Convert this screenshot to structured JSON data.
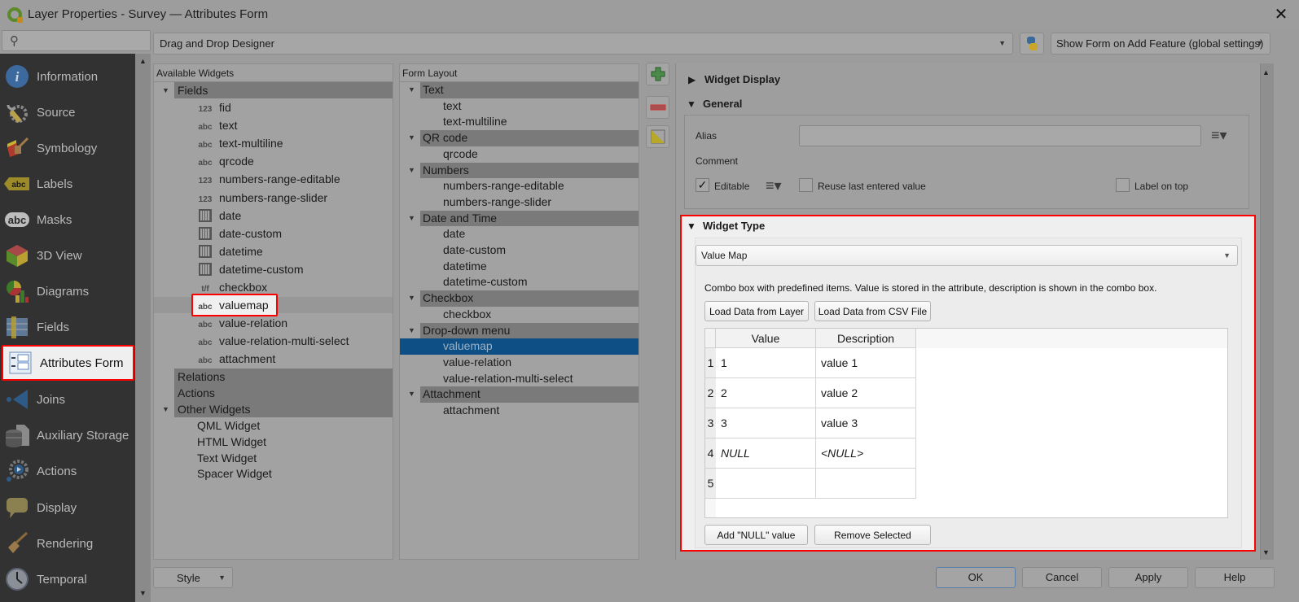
{
  "window": {
    "title": "Layer Properties - Survey — Attributes Form",
    "close_icon": "✕"
  },
  "sidebar": {
    "search_placeholder": "",
    "items": [
      {
        "label": "Information",
        "icon": "information-icon"
      },
      {
        "label": "Source",
        "icon": "source-icon"
      },
      {
        "label": "Symbology",
        "icon": "symbology-icon"
      },
      {
        "label": "Labels",
        "icon": "labels-icon"
      },
      {
        "label": "Masks",
        "icon": "masks-icon"
      },
      {
        "label": "3D View",
        "icon": "3d-view-icon"
      },
      {
        "label": "Diagrams",
        "icon": "diagrams-icon"
      },
      {
        "label": "Fields",
        "icon": "fields-icon"
      },
      {
        "label": "Attributes Form",
        "icon": "attributes-form-icon",
        "active": true
      },
      {
        "label": "Joins",
        "icon": "joins-icon"
      },
      {
        "label": "Auxiliary Storage",
        "icon": "auxiliary-storage-icon"
      },
      {
        "label": "Actions",
        "icon": "actions-icon"
      },
      {
        "label": "Display",
        "icon": "display-icon"
      },
      {
        "label": "Rendering",
        "icon": "rendering-icon"
      },
      {
        "label": "Temporal",
        "icon": "temporal-icon"
      }
    ]
  },
  "toolbar": {
    "mode": "Drag and Drop Designer",
    "show_form": "Show Form on Add Feature (global settings)"
  },
  "available_widgets": {
    "header": "Available Widgets",
    "fields_group": "Fields",
    "fields": [
      {
        "type": "123",
        "name": "fid"
      },
      {
        "type": "abc",
        "name": "text"
      },
      {
        "type": "abc",
        "name": "text-multiline"
      },
      {
        "type": "abc",
        "name": "qrcode"
      },
      {
        "type": "123",
        "name": "numbers-range-editable"
      },
      {
        "type": "123",
        "name": "numbers-range-slider"
      },
      {
        "type": "date",
        "name": "date"
      },
      {
        "type": "date",
        "name": "date-custom"
      },
      {
        "type": "datetime",
        "name": "datetime"
      },
      {
        "type": "datetime",
        "name": "datetime-custom"
      },
      {
        "type": "t/f",
        "name": "checkbox"
      },
      {
        "type": "abc",
        "name": "valuemap"
      },
      {
        "type": "abc",
        "name": "value-relation"
      },
      {
        "type": "abc",
        "name": "value-relation-multi-select"
      },
      {
        "type": "abc",
        "name": "attachment"
      }
    ],
    "relations_group": "Relations",
    "actions_group": "Actions",
    "other_group": "Other Widgets",
    "other": [
      "QML Widget",
      "HTML Widget",
      "Text Widget",
      "Spacer Widget"
    ]
  },
  "form_layout": {
    "header": "Form Layout",
    "groups": [
      {
        "name": "Text",
        "items": [
          "text",
          "text-multiline"
        ]
      },
      {
        "name": "QR code",
        "items": [
          "qrcode"
        ]
      },
      {
        "name": "Numbers",
        "items": [
          "numbers-range-editable",
          "numbers-range-slider"
        ]
      },
      {
        "name": "Date and Time",
        "items": [
          "date",
          "date-custom",
          "datetime",
          "datetime-custom"
        ]
      },
      {
        "name": "Checkbox",
        "items": [
          "checkbox"
        ]
      },
      {
        "name": "Drop-down menu",
        "items": [
          "valuemap",
          "value-relation",
          "value-relation-multi-select"
        ]
      },
      {
        "name": "Attachment",
        "items": [
          "attachment"
        ]
      }
    ],
    "selected": "valuemap"
  },
  "config": {
    "widget_display": "Widget Display",
    "general": "General",
    "alias_label": "Alias",
    "alias_value": "",
    "comment_label": "Comment",
    "editable_label": "Editable",
    "editable_checked": true,
    "reuse_label": "Reuse last entered value",
    "reuse_checked": false,
    "label_on_top": "Label on top",
    "label_on_top_checked": false,
    "widget_type_title": "Widget Type",
    "widget_type": "Value Map",
    "description": "Combo box with predefined items. Value is stored in the attribute, description is shown in the combo box.",
    "load_layer_btn": "Load Data from Layer",
    "load_csv_btn": "Load Data from CSV File",
    "table": {
      "columns": [
        "Value",
        "Description"
      ],
      "rows": [
        {
          "n": "1",
          "value": "1",
          "description": "value 1"
        },
        {
          "n": "2",
          "value": "2",
          "description": "value 2"
        },
        {
          "n": "3",
          "value": "3",
          "description": "value 3"
        },
        {
          "n": "4",
          "value": "NULL",
          "description": "<NULL>"
        },
        {
          "n": "5",
          "value": "",
          "description": ""
        }
      ]
    },
    "add_null_btn": "Add \"NULL\" value",
    "remove_selected_btn": "Remove Selected"
  },
  "footer": {
    "style": "Style",
    "ok": "OK",
    "cancel": "Cancel",
    "apply": "Apply",
    "help": "Help"
  }
}
